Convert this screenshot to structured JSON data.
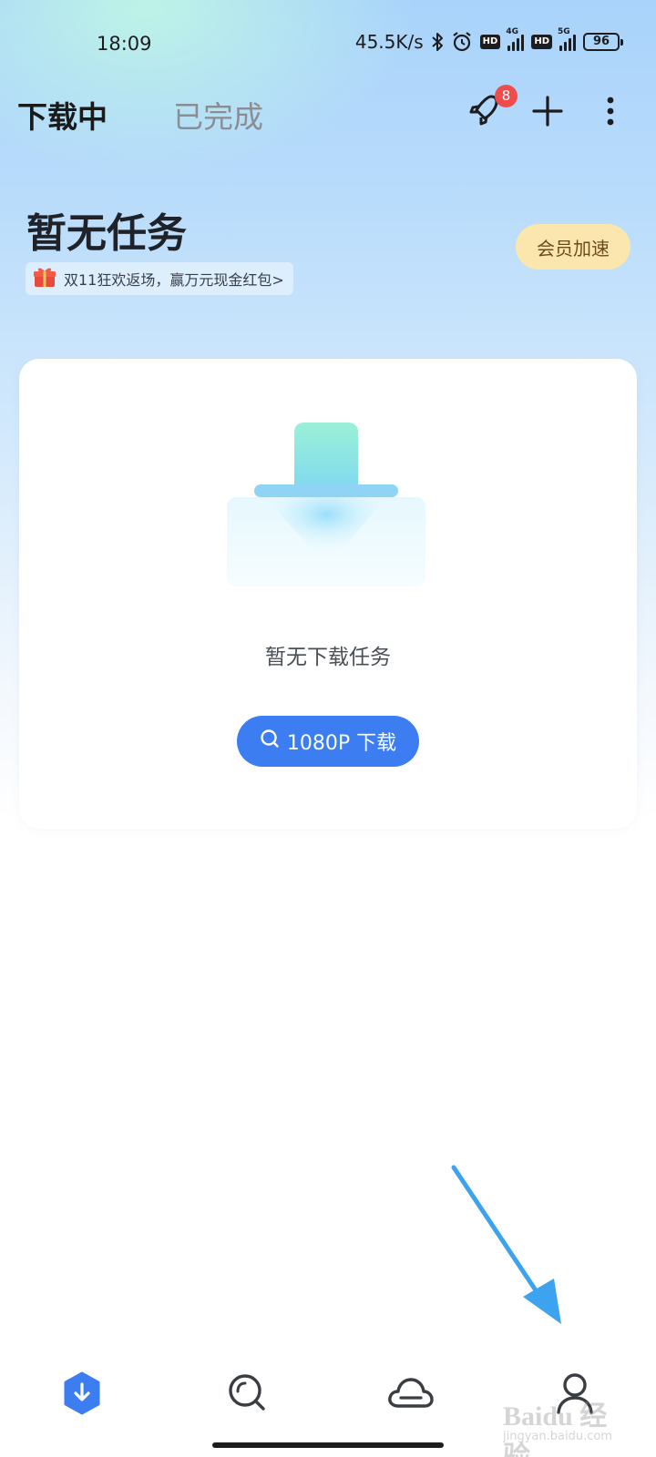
{
  "status_bar": {
    "time": "18:09",
    "network_speed": "45.5K/s",
    "sim1_network": "4G",
    "sim2_network": "5G",
    "hd_label": "HD",
    "battery": "96"
  },
  "header": {
    "tabs": [
      {
        "label": "下载中",
        "active": true
      },
      {
        "label": "已完成",
        "active": false
      }
    ],
    "rocket_badge_count": "8"
  },
  "summary": {
    "title": "暂无任务",
    "promo_text": "双11狂欢返场，赢万元现金红包>",
    "vip_button": "会员加速"
  },
  "empty_card": {
    "message": "暂无下载任务",
    "button_label": "1080P 下载"
  },
  "bottom_nav": {
    "items": [
      {
        "icon": "download-icon",
        "active": true
      },
      {
        "icon": "search-icon",
        "active": false
      },
      {
        "icon": "cloud-icon",
        "active": false
      },
      {
        "icon": "profile-icon",
        "active": false
      }
    ]
  },
  "watermark": {
    "text": "Baidu 经验",
    "sub": "jingyan.baidu.com"
  },
  "colors": {
    "accent": "#3c7df2",
    "badge": "#f04c4c",
    "vip_bg": "#fbe7ad",
    "annotation_arrow": "#3ea3ef"
  }
}
